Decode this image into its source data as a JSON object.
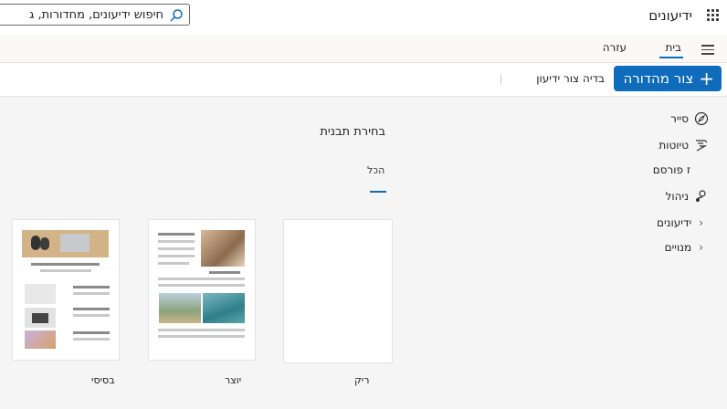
{
  "header": {
    "app_name": "ידיעונים",
    "search_text": "חיפוש ידיעונים, מחדורות, ג"
  },
  "tabs": {
    "home": "בית",
    "help": "עזרה"
  },
  "toolbar": {
    "new_edition": "צור מהדורה",
    "check_newsletter": "בדיה צור ידיעון"
  },
  "nav": {
    "items": [
      {
        "label": "סייר",
        "icon": "compass-icon"
      },
      {
        "label": "טיוטות",
        "icon": "draft-pen-icon"
      },
      {
        "label": "ז פורסם",
        "icon": ""
      },
      {
        "label": "ניהול",
        "icon": "person-gear-icon"
      },
      {
        "label": "ידיעונים",
        "icon": "chevron-right-icon"
      },
      {
        "label": "מנויים",
        "icon": "chevron-right-icon"
      }
    ]
  },
  "main": {
    "title": "בחירת תבנית",
    "filter": "הכל",
    "templates": [
      {
        "label": "ריק"
      },
      {
        "label": "יוצר"
      },
      {
        "label": "בסיסי"
      }
    ]
  },
  "colors": {
    "accent": "#0f6cbd"
  }
}
